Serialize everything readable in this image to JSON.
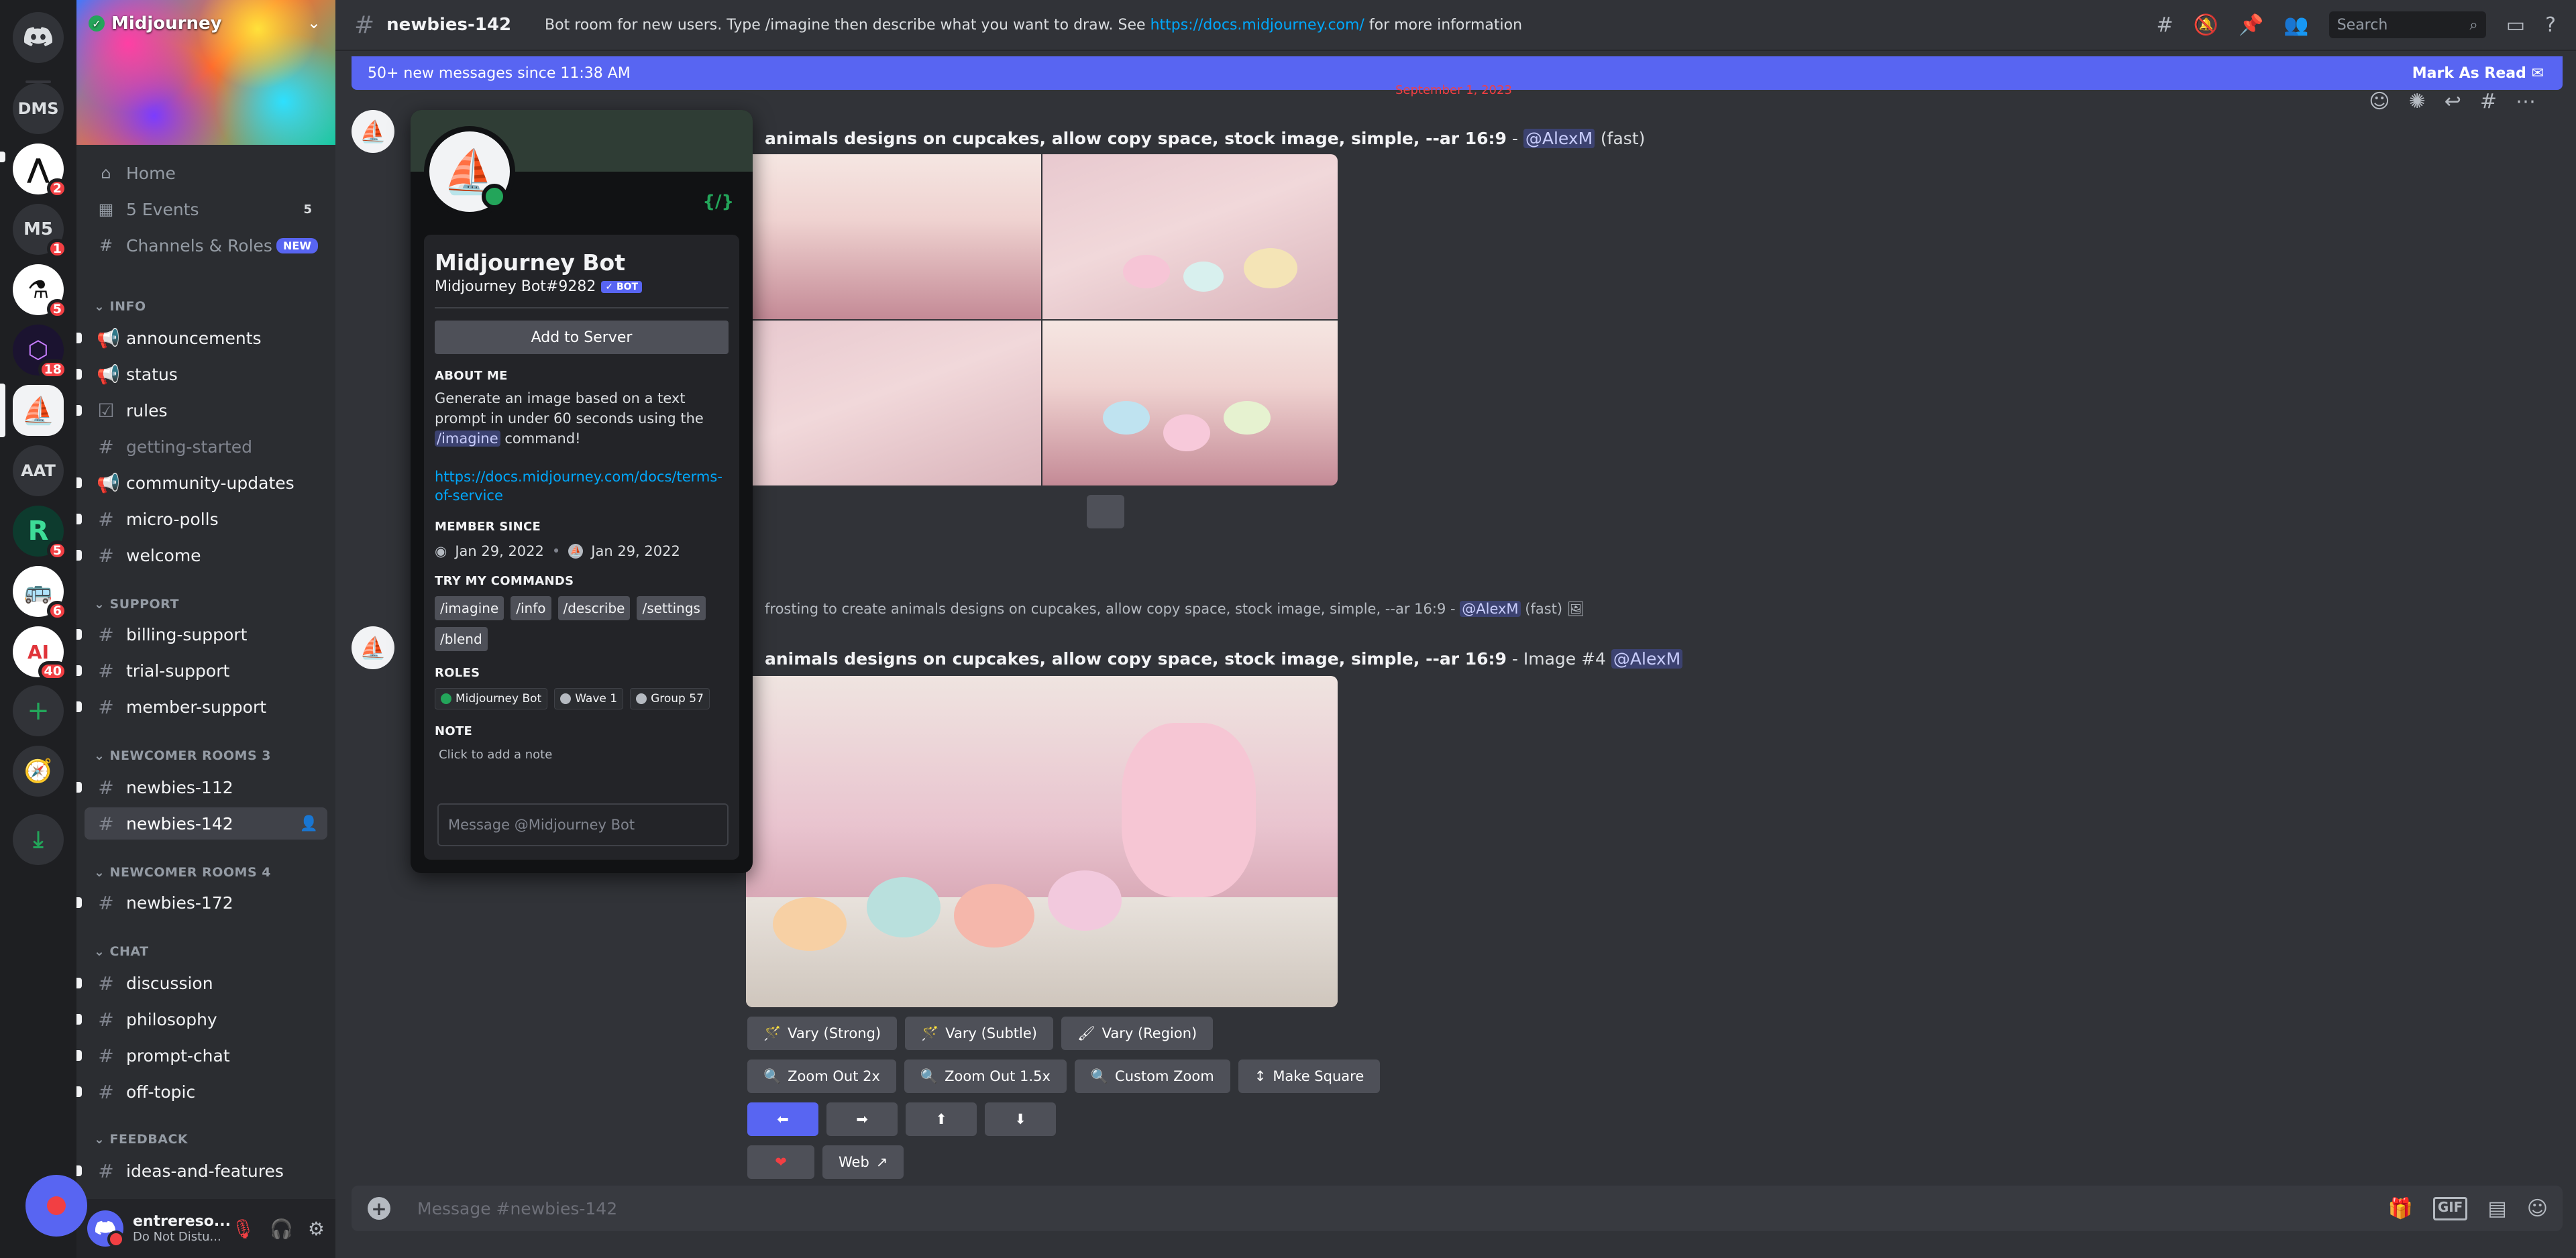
{
  "rail": {
    "dms_label": "DMS",
    "m5_label": "M5",
    "m5_badge": "1",
    "aat_label": "AAT",
    "badges": [
      "2",
      "5",
      "18",
      "5",
      "6",
      "40"
    ]
  },
  "server": {
    "name": "Midjourney",
    "nav": [
      {
        "label": "Home",
        "icon": "home-icon"
      },
      {
        "label": "5 Events",
        "icon": "calendar-icon",
        "count": "5"
      },
      {
        "label": "Channels & Roles",
        "icon": "hash-icon",
        "tag": "NEW"
      }
    ],
    "categories": {
      "info": "INFO",
      "support": "SUPPORT",
      "newcomer3": "NEWCOMER ROOMS 3",
      "newcomer4": "NEWCOMER ROOMS 4",
      "chat": "CHAT",
      "feedback": "FEEDBACK"
    },
    "channels": {
      "announcements": "announcements",
      "status": "status",
      "rules": "rules",
      "getting_started": "getting-started",
      "community_updates": "community-updates",
      "micro_polls": "micro-polls",
      "welcome": "welcome",
      "billing_support": "billing-support",
      "trial_support": "trial-support",
      "member_support": "member-support",
      "newbies_112": "newbies-112",
      "newbies_142": "newbies-142",
      "newbies_172": "newbies-172",
      "discussion": "discussion",
      "philosophy": "philosophy",
      "prompt_chat": "prompt-chat",
      "off_topic": "off-topic",
      "ideas_and_features": "ideas-and-features"
    }
  },
  "user": {
    "name": "entrereso...",
    "status": "Do Not Distu..."
  },
  "header": {
    "channel": "newbies-142",
    "topic_prefix": "Bot room for new users. Type /imagine then describe what you want to draw. See",
    "topic_link": "https://docs.midjourney.com/",
    "topic_suffix": "for more information",
    "search_placeholder": "Search"
  },
  "newbar": {
    "text": "50+ new messages since 11:38 AM",
    "mark_read": "Mark As Read"
  },
  "messages": {
    "date_divider": "September 1, 2023",
    "msg1_prompt": "animals designs on cupcakes, allow copy space, stock image, simple, --ar 16:9",
    "msg1_sep": " - ",
    "msg1_mention": "@AlexM",
    "msg1_mode": "(fast)",
    "reply_text": "frosting to create animals designs on cupcakes, allow copy space, stock image, simple, --ar 16:9 -",
    "reply_mention": "@AlexM",
    "reply_mode": "(fast)",
    "msg2_prompt": "animals designs on cupcakes, allow copy space, stock image, simple, --ar 16:9",
    "msg2_suffix": " - Image #4 ",
    "msg2_mention": "@AlexM"
  },
  "buttons": {
    "vary_strong": "Vary (Strong)",
    "vary_subtle": "Vary (Subtle)",
    "vary_region": "Vary (Region)",
    "zoom_2x": "Zoom Out 2x",
    "zoom_15x": "Zoom Out 1.5x",
    "custom_zoom": "Custom Zoom",
    "make_square": "Make Square",
    "web": "Web"
  },
  "composer": {
    "placeholder": "Message #newbies-142"
  },
  "profile": {
    "name": "Midjourney Bot",
    "tag": "Midjourney Bot#9282",
    "bot_label": "BOT",
    "add_to_server": "Add to Server",
    "about_heading": "ABOUT ME",
    "about_pre": "Generate an image based on a text prompt in under 60 seconds using the",
    "about_cmd": "/imagine",
    "about_post": "command!",
    "link": "https://docs.midjourney.com/docs/terms-of-service",
    "member_since_heading": "MEMBER SINCE",
    "member_since_discord": "Jan 29, 2022",
    "member_since_server": "Jan 29, 2022",
    "commands_heading": "TRY MY COMMANDS",
    "commands": [
      "/imagine",
      "/info",
      "/describe",
      "/settings",
      "/blend"
    ],
    "roles_heading": "ROLES",
    "roles": [
      {
        "name": "Midjourney Bot",
        "color": "#23a55a"
      },
      {
        "name": "Wave 1",
        "color": "#b5bac1"
      },
      {
        "name": "Group 57",
        "color": "#b5bac1"
      }
    ],
    "note_heading": "NOTE",
    "note_placeholder": "Click to add a note",
    "message_placeholder": "Message @Midjourney Bot",
    "code_icon": "{/}"
  }
}
